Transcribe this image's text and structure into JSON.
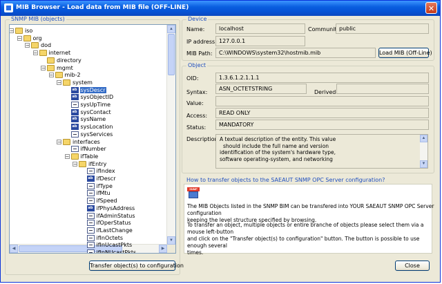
{
  "window": {
    "title": "MIB Browser - Load data from MIB file (OFF-LINE)",
    "close_glyph": "✕"
  },
  "tree": {
    "group_label": "SNMP MIB (objects)",
    "nodes": [
      {
        "label": "iso",
        "level": 0,
        "type": "folder",
        "expand": "−"
      },
      {
        "label": "org",
        "level": 1,
        "type": "folder",
        "expand": "−"
      },
      {
        "label": "dod",
        "level": 2,
        "type": "folder",
        "expand": "−"
      },
      {
        "label": "internet",
        "level": 3,
        "type": "folder",
        "expand": "−"
      },
      {
        "label": "directory",
        "level": 4,
        "type": "folder",
        "expand": ""
      },
      {
        "label": "mgmt",
        "level": 4,
        "type": "folder",
        "expand": "−"
      },
      {
        "label": "mib-2",
        "level": 5,
        "type": "folder",
        "expand": "−"
      },
      {
        "label": "system",
        "level": 6,
        "type": "folder",
        "expand": "−"
      },
      {
        "label": "sysDescr",
        "level": 7,
        "type": "abc",
        "expand": "",
        "selected": true
      },
      {
        "label": "sysObjectID",
        "level": 7,
        "type": "abc",
        "expand": ""
      },
      {
        "label": "sysUpTime",
        "level": 7,
        "type": "leaf",
        "expand": ""
      },
      {
        "label": "sysContact",
        "level": 7,
        "type": "abc",
        "expand": ""
      },
      {
        "label": "sysName",
        "level": 7,
        "type": "abc",
        "expand": ""
      },
      {
        "label": "sysLocation",
        "level": 7,
        "type": "abc",
        "expand": ""
      },
      {
        "label": "sysServices",
        "level": 7,
        "type": "leaf",
        "expand": ""
      },
      {
        "label": "interfaces",
        "level": 6,
        "type": "folder",
        "expand": "−"
      },
      {
        "label": "ifNumber",
        "level": 7,
        "type": "leaf",
        "expand": ""
      },
      {
        "label": "ifTable",
        "level": 7,
        "type": "folder",
        "expand": "−"
      },
      {
        "label": "ifEntry",
        "level": 8,
        "type": "folder",
        "expand": "−"
      },
      {
        "label": "ifIndex",
        "level": 9,
        "type": "leaf",
        "expand": ""
      },
      {
        "label": "ifDescr",
        "level": 9,
        "type": "abc",
        "expand": ""
      },
      {
        "label": "ifType",
        "level": 9,
        "type": "leaf",
        "expand": ""
      },
      {
        "label": "ifMtu",
        "level": 9,
        "type": "leaf",
        "expand": ""
      },
      {
        "label": "ifSpeed",
        "level": 9,
        "type": "leaf",
        "expand": ""
      },
      {
        "label": "ifPhysAddress",
        "level": 9,
        "type": "abc",
        "expand": ""
      },
      {
        "label": "ifAdminStatus",
        "level": 9,
        "type": "leaf",
        "expand": ""
      },
      {
        "label": "ifOperStatus",
        "level": 9,
        "type": "leaf",
        "expand": ""
      },
      {
        "label": "ifLastChange",
        "level": 9,
        "type": "leaf",
        "expand": ""
      },
      {
        "label": "ifInOctets",
        "level": 9,
        "type": "leaf",
        "expand": ""
      },
      {
        "label": "ifInUcastPkts",
        "level": 9,
        "type": "leaf",
        "expand": ""
      },
      {
        "label": "ifInNUcastPkts",
        "level": 9,
        "type": "leaf",
        "expand": ""
      }
    ],
    "transfer_button": "Transfer object(s) to configuration"
  },
  "device": {
    "group_label": "Device",
    "name_label": "Name:",
    "name_value": "localhost",
    "community_label": "Community:",
    "community_value": "public",
    "ip_label": "IP address:",
    "ip_value": "127.0.0.1",
    "mibpath_label": "MIB Path:",
    "mibpath_value": "C:\\WINDOWS\\system32\\hostmib.mib",
    "load_button": "Load MIB (Off-Line)"
  },
  "object": {
    "group_label": "Object",
    "oid_label": "OID:",
    "oid_value": "1.3.6.1.2.1.1.1",
    "syntax_label": "Syntax:",
    "syntax_value": "ASN_OCTETSTRING",
    "derived_label": "Derived:",
    "derived_value": "",
    "value_label": "Value:",
    "value_value": "",
    "access_label": "Access:",
    "access_value": "READ ONLY",
    "status_label": "Status:",
    "status_value": "MANDATORY",
    "description_label": "Description:",
    "description_lines": [
      "A textual description of the entity. This value",
      "should include the full name and version",
      "identification of the system's hardware type,",
      "software operating-system, and networking"
    ]
  },
  "howto": {
    "group_label": "How to transfer objects to the SAEAUT SNMP OPC Server configuration?",
    "icon_text": "SNMP",
    "para1_lines": [
      "The MIB Objects listed in the SNMP BIM can be transfered into YOUR SAEAUT SNMP OPC Server configuration",
      "keeping the level structure specified by browsing."
    ],
    "para2_lines": [
      "To transfer an object, multiple objects or entire branche of objects please select them via a mouse left-button",
      "and click on the  \"Transfer object(s) to configuration\" button. The button is possible to use enough several",
      "times."
    ]
  },
  "close_button": "Close"
}
